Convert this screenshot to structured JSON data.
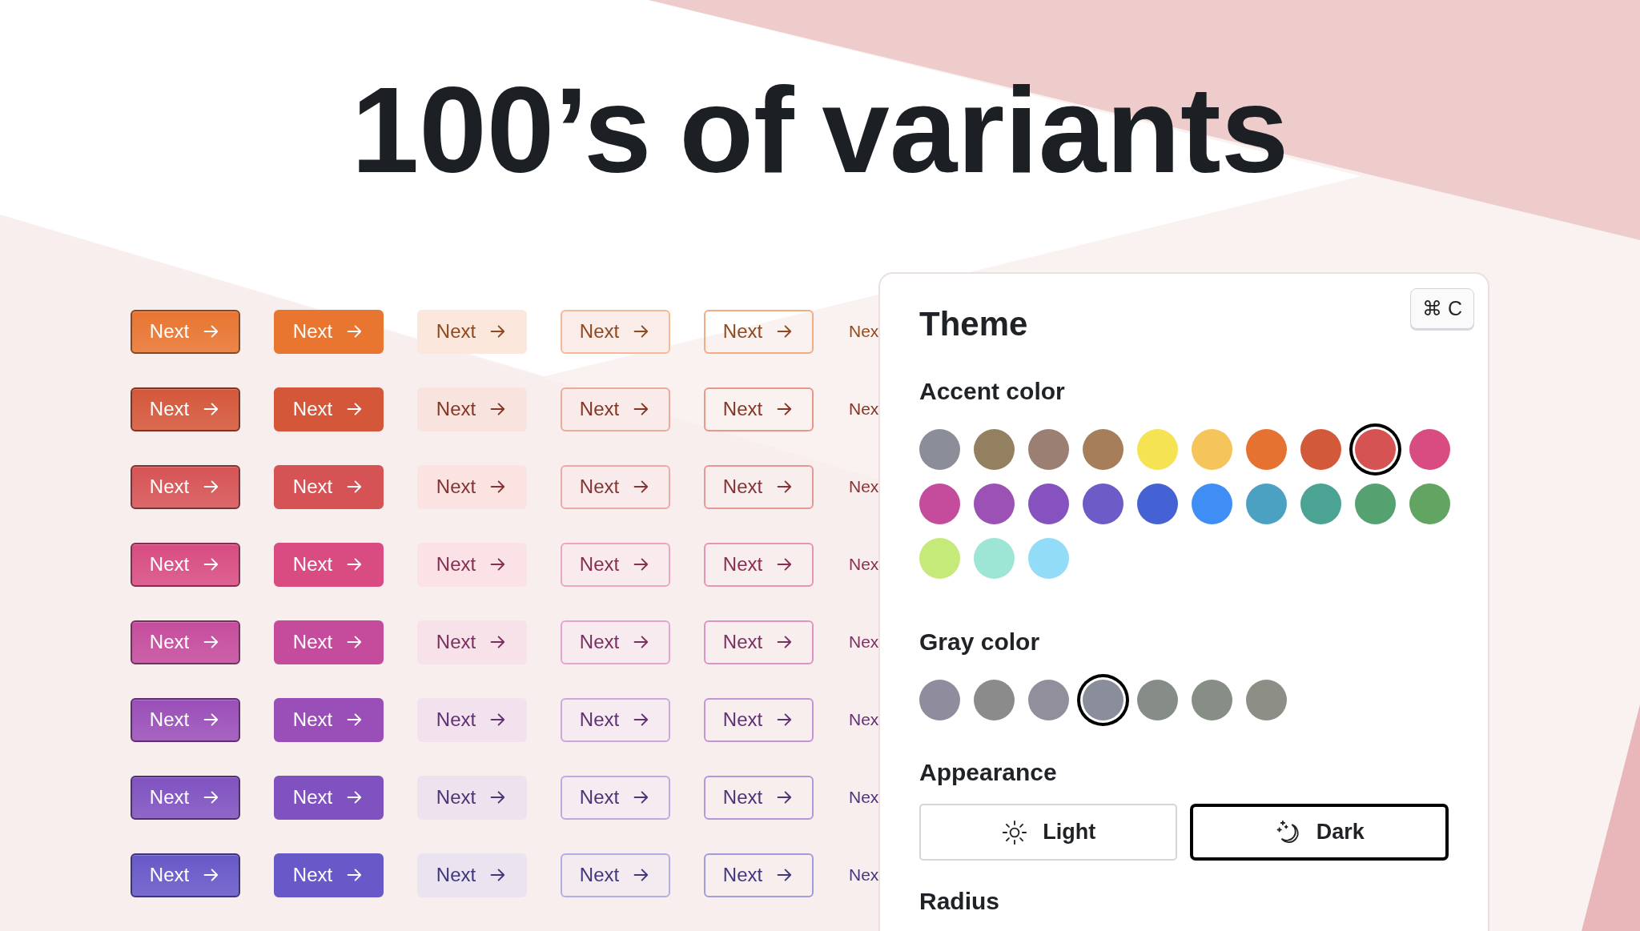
{
  "heading": "100’s of variants",
  "button_rows": [
    {
      "color": "#e87530",
      "buttons": [
        {
          "kind": "classic",
          "label": "Next"
        },
        {
          "kind": "solid",
          "label": "Next"
        },
        {
          "kind": "soft",
          "label": "Next"
        },
        {
          "kind": "surface",
          "label": "Next"
        },
        {
          "kind": "outline",
          "label": "Next"
        },
        {
          "kind": "ghost",
          "label": "Nex"
        }
      ]
    },
    {
      "color": "#d4573a",
      "buttons": [
        {
          "kind": "classic",
          "label": "Next"
        },
        {
          "kind": "solid",
          "label": "Next"
        },
        {
          "kind": "soft",
          "label": "Next"
        },
        {
          "kind": "surface",
          "label": "Next"
        },
        {
          "kind": "outline",
          "label": "Next"
        },
        {
          "kind": "ghost",
          "label": "Nex"
        }
      ]
    },
    {
      "color": "#d65355",
      "buttons": [
        {
          "kind": "classic",
          "label": "Next"
        },
        {
          "kind": "solid",
          "label": "Next"
        },
        {
          "kind": "soft",
          "label": "Next"
        },
        {
          "kind": "surface",
          "label": "Next"
        },
        {
          "kind": "outline",
          "label": "Next"
        },
        {
          "kind": "ghost",
          "label": "Nex"
        }
      ]
    },
    {
      "color": "#d84c82",
      "buttons": [
        {
          "kind": "classic",
          "label": "Next"
        },
        {
          "kind": "solid",
          "label": "Next"
        },
        {
          "kind": "soft",
          "label": "Next"
        },
        {
          "kind": "surface",
          "label": "Next"
        },
        {
          "kind": "outline",
          "label": "Next"
        },
        {
          "kind": "ghost",
          "label": "Nex"
        }
      ]
    },
    {
      "color": "#c54c9d",
      "buttons": [
        {
          "kind": "classic",
          "label": "Next"
        },
        {
          "kind": "solid",
          "label": "Next"
        },
        {
          "kind": "soft",
          "label": "Next"
        },
        {
          "kind": "surface",
          "label": "Next"
        },
        {
          "kind": "outline",
          "label": "Next"
        },
        {
          "kind": "ghost",
          "label": "Nex"
        }
      ]
    },
    {
      "color": "#9a4fb8",
      "buttons": [
        {
          "kind": "classic",
          "label": "Next"
        },
        {
          "kind": "solid",
          "label": "Next"
        },
        {
          "kind": "soft",
          "label": "Next"
        },
        {
          "kind": "surface",
          "label": "Next"
        },
        {
          "kind": "outline",
          "label": "Next"
        },
        {
          "kind": "ghost",
          "label": "Nex"
        }
      ]
    },
    {
      "color": "#8052c0",
      "buttons": [
        {
          "kind": "classic",
          "label": "Next"
        },
        {
          "kind": "solid",
          "label": "Next"
        },
        {
          "kind": "soft",
          "label": "Next"
        },
        {
          "kind": "surface",
          "label": "Next"
        },
        {
          "kind": "outline",
          "label": "Next"
        },
        {
          "kind": "ghost",
          "label": "Nex"
        }
      ]
    },
    {
      "color": "#6858c8",
      "buttons": [
        {
          "kind": "classic",
          "label": "Next"
        },
        {
          "kind": "solid",
          "label": "Next"
        },
        {
          "kind": "soft",
          "label": "Next"
        },
        {
          "kind": "surface",
          "label": "Next"
        },
        {
          "kind": "outline",
          "label": "Next"
        },
        {
          "kind": "ghost",
          "label": "Nex"
        }
      ]
    }
  ],
  "panel": {
    "shortcut": "⌘ C",
    "title": "Theme",
    "accent": {
      "label": "Accent color",
      "swatches": [
        {
          "color": "#8b8d98",
          "selected": false
        },
        {
          "color": "#928060",
          "selected": false
        },
        {
          "color": "#9c7f73",
          "selected": false
        },
        {
          "color": "#a67f5a",
          "selected": false
        },
        {
          "color": "#f6e354",
          "selected": false
        },
        {
          "color": "#f5c45a",
          "selected": false
        },
        {
          "color": "#e57231",
          "selected": false
        },
        {
          "color": "#d2593a",
          "selected": false
        },
        {
          "color": "#d55352",
          "selected": true
        },
        {
          "color": "#d84c82",
          "selected": false
        },
        {
          "color": "#c54c9d",
          "selected": false
        },
        {
          "color": "#9c51b5",
          "selected": false
        },
        {
          "color": "#8652bf",
          "selected": false
        },
        {
          "color": "#6d5bc8",
          "selected": false
        },
        {
          "color": "#4562d4",
          "selected": false
        },
        {
          "color": "#3e8ef5",
          "selected": false
        },
        {
          "color": "#4aa1c1",
          "selected": false
        },
        {
          "color": "#4aa393",
          "selected": false
        },
        {
          "color": "#56a170",
          "selected": false
        },
        {
          "color": "#62a562",
          "selected": false
        },
        {
          "color": "#c6ea7a",
          "selected": false
        },
        {
          "color": "#9de6d6",
          "selected": false
        },
        {
          "color": "#93dcf7",
          "selected": false
        }
      ]
    },
    "gray": {
      "label": "Gray color",
      "swatches": [
        {
          "color": "#8f8d9d",
          "selected": false
        },
        {
          "color": "#8b8b8b",
          "selected": false
        },
        {
          "color": "#918f9c",
          "selected": false
        },
        {
          "color": "#8a8e9a",
          "selected": true
        },
        {
          "color": "#868d89",
          "selected": false
        },
        {
          "color": "#878e86",
          "selected": false
        },
        {
          "color": "#8d8e86",
          "selected": false
        }
      ]
    },
    "appearance": {
      "label": "Appearance",
      "options": [
        {
          "kind": "light",
          "label": "Light",
          "selected": false
        },
        {
          "kind": "dark",
          "label": "Dark",
          "selected": true
        }
      ]
    },
    "radius": {
      "label": "Radius"
    }
  }
}
